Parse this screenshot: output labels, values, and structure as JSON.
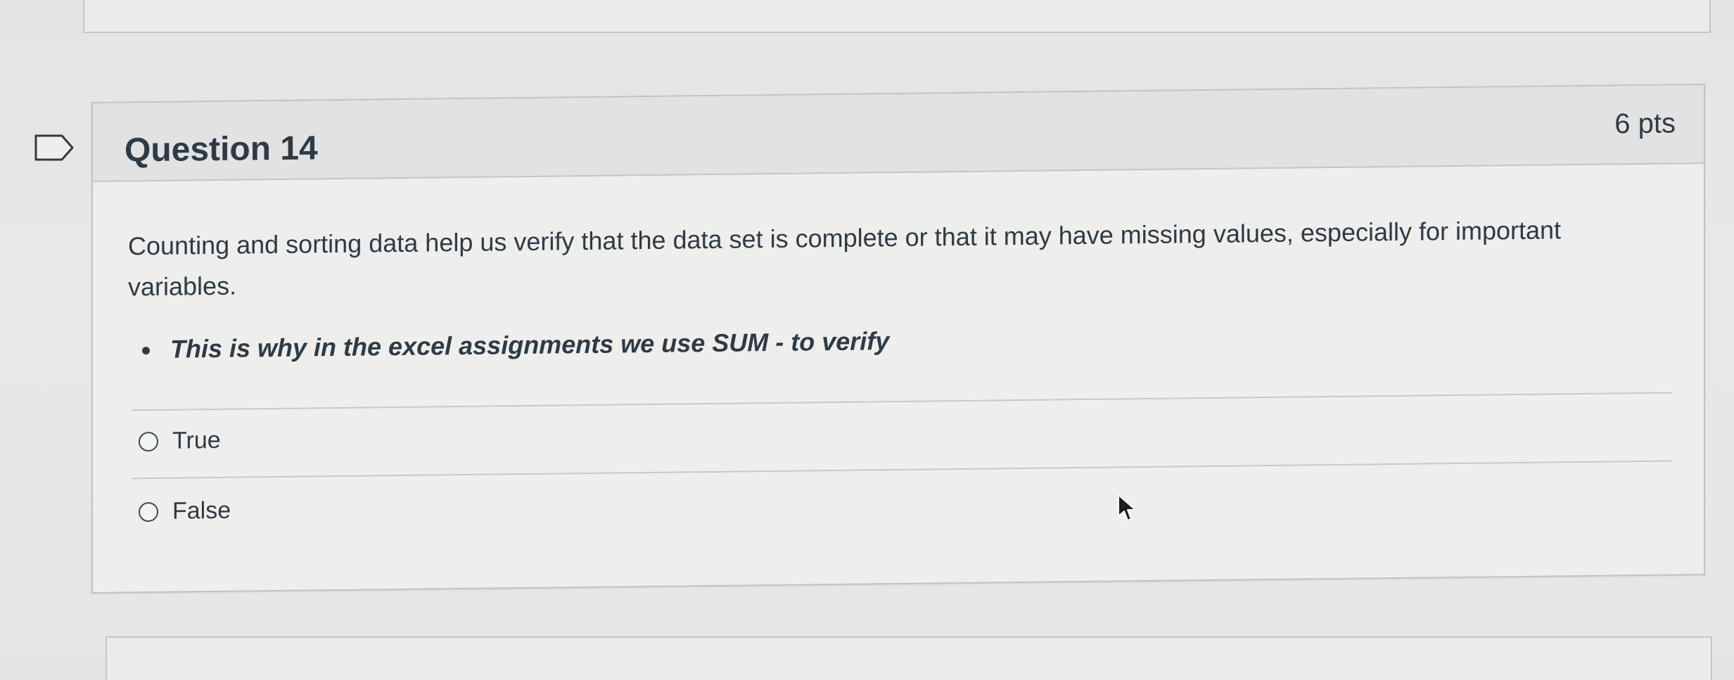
{
  "question": {
    "title": "Question 14",
    "points": "6 pts",
    "body": "Counting and sorting data help us verify that the data set is complete or that it may have missing values, especially for important variables.",
    "bullets": [
      "This is why in the excel assignments we use SUM - to verify"
    ]
  },
  "answers": [
    {
      "label": "True",
      "selected": false
    },
    {
      "label": "False",
      "selected": false
    }
  ],
  "icons": {
    "flag": "flag-bookmark-icon",
    "cursor": "mouse-pointer-icon"
  },
  "colors": {
    "text": "#2d3b45",
    "header_bg": "#e1e2e1",
    "border": "#c3c6c8"
  }
}
